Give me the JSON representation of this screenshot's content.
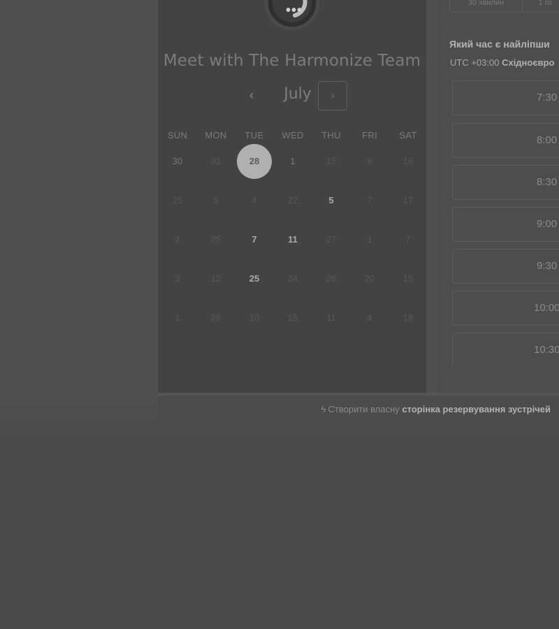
{
  "header": {
    "avatar_text": "•••",
    "title": "Meet with The Harmonize Team"
  },
  "calendar": {
    "prev_icon": "‹",
    "next_icon": "›",
    "month": "July",
    "weekdays": [
      "SUN",
      "MON",
      "TUE",
      "WED",
      "THU",
      "FRI",
      "SAT"
    ],
    "weeks": [
      [
        {
          "d": "30",
          "s": "cur"
        },
        {
          "d": "31",
          "s": "muted"
        },
        {
          "d": "28",
          "s": "selected"
        },
        {
          "d": "1",
          "s": "cur"
        },
        {
          "d": "15",
          "s": "muted"
        },
        {
          "d": "8",
          "s": "muted"
        },
        {
          "d": "16",
          "s": "muted"
        }
      ],
      [
        {
          "d": "25",
          "s": "muted"
        },
        {
          "d": "5",
          "s": "muted"
        },
        {
          "d": "4",
          "s": "muted"
        },
        {
          "d": "22",
          "s": "muted"
        },
        {
          "d": "5",
          "s": "avail"
        },
        {
          "d": "7",
          "s": "muted"
        },
        {
          "d": "17",
          "s": "muted"
        }
      ],
      [
        {
          "d": "4",
          "s": "muted"
        },
        {
          "d": "25",
          "s": "muted"
        },
        {
          "d": "7",
          "s": "avail"
        },
        {
          "d": "11",
          "s": "avail"
        },
        {
          "d": "27",
          "s": "muted"
        },
        {
          "d": "1",
          "s": "muted"
        },
        {
          "d": "7",
          "s": "muted"
        }
      ],
      [
        {
          "d": "3",
          "s": "muted"
        },
        {
          "d": "12",
          "s": "muted"
        },
        {
          "d": "25",
          "s": "avail"
        },
        {
          "d": "24",
          "s": "muted"
        },
        {
          "d": "26",
          "s": "muted"
        },
        {
          "d": "20",
          "s": "muted"
        },
        {
          "d": "15",
          "s": "muted"
        }
      ],
      [
        {
          "d": "1",
          "s": "muted"
        },
        {
          "d": "26",
          "s": "muted"
        },
        {
          "d": "10",
          "s": "muted"
        },
        {
          "d": "15",
          "s": "muted"
        },
        {
          "d": "11",
          "s": "muted"
        },
        {
          "d": "4",
          "s": "muted"
        },
        {
          "d": "18",
          "s": "muted"
        }
      ]
    ]
  },
  "durations": [
    "30 хвилин",
    "1 го"
  ],
  "booking": {
    "question": "Який час є найліпши",
    "tz_offset": "UTC +03:00",
    "tz_name": "Східноєвро"
  },
  "slots": [
    "7:30",
    "8:00",
    "8:30",
    "9:00",
    "9:30",
    "10:00",
    "10:30"
  ],
  "footer": {
    "logo_icon": "ϟ",
    "prefix": "Створити власну",
    "link": "сторінка резервування зустрічей"
  },
  "colors": {
    "overlay": "#4a4a4a",
    "selected_day": "#b0b0b0"
  }
}
